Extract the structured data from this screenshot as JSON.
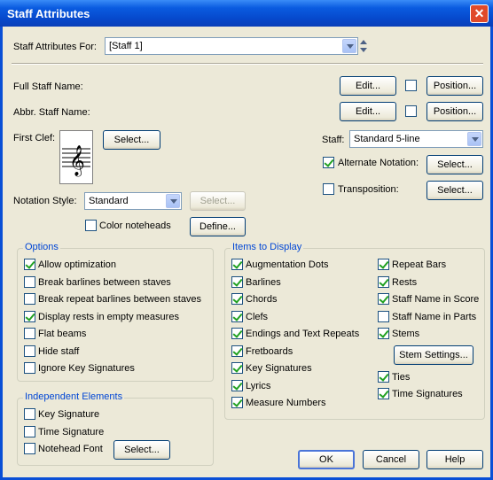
{
  "window": {
    "title": "Staff Attributes",
    "close_glyph": "✕"
  },
  "top": {
    "staff_for_label": "Staff Attributes For:",
    "staff_for_value": "[Staff 1]",
    "full_name_label": "Full Staff Name:",
    "abbr_name_label": "Abbr. Staff Name:",
    "edit_label": "Edit...",
    "position_label": "Position..."
  },
  "clef": {
    "label": "First Clef:",
    "select_label": "Select..."
  },
  "staff": {
    "label": "Staff:",
    "value": "Standard 5-line",
    "alternate_notation": {
      "label": "Alternate Notation:",
      "checked": true
    },
    "transposition": {
      "label": "Transposition:",
      "checked": false
    },
    "select_label": "Select..."
  },
  "notation": {
    "label": "Notation Style:",
    "value": "Standard",
    "select_label": "Select...",
    "color_noteheads": {
      "label": "Color noteheads",
      "checked": false
    },
    "define_label": "Define..."
  },
  "options": {
    "title": "Options",
    "items": [
      {
        "label": "Allow optimization",
        "checked": true
      },
      {
        "label": "Break barlines between staves",
        "checked": false
      },
      {
        "label": "Break repeat barlines between staves",
        "checked": false
      },
      {
        "label": "Display rests in empty measures",
        "checked": true
      },
      {
        "label": "Flat beams",
        "checked": false
      },
      {
        "label": "Hide staff",
        "checked": false
      },
      {
        "label": "Ignore Key Signatures",
        "checked": false
      }
    ]
  },
  "independent": {
    "title": "Independent Elements",
    "items": [
      {
        "label": "Key Signature",
        "checked": false
      },
      {
        "label": "Time Signature",
        "checked": false
      },
      {
        "label": "Notehead Font",
        "checked": false
      }
    ],
    "select_label": "Select..."
  },
  "display": {
    "title": "Items to Display",
    "left": [
      {
        "label": "Augmentation Dots",
        "checked": true
      },
      {
        "label": "Barlines",
        "checked": true
      },
      {
        "label": "Chords",
        "checked": true
      },
      {
        "label": "Clefs",
        "checked": true
      },
      {
        "label": "Endings and Text Repeats",
        "checked": true
      },
      {
        "label": "Fretboards",
        "checked": true
      },
      {
        "label": "Key Signatures",
        "checked": true
      },
      {
        "label": "Lyrics",
        "checked": true
      },
      {
        "label": "Measure Numbers",
        "checked": true
      }
    ],
    "right": [
      {
        "label": "Repeat Bars",
        "checked": true
      },
      {
        "label": "Rests",
        "checked": true
      },
      {
        "label": "Staff Name in Score",
        "checked": true
      },
      {
        "label": "Staff Name in Parts",
        "checked": false
      },
      {
        "label": "Stems",
        "checked": true
      },
      {
        "label": "Ties",
        "checked": true
      },
      {
        "label": "Time Signatures",
        "checked": true
      }
    ],
    "stem_settings_label": "Stem Settings..."
  },
  "footer": {
    "ok_label": "OK",
    "cancel_label": "Cancel",
    "help_label": "Help"
  }
}
